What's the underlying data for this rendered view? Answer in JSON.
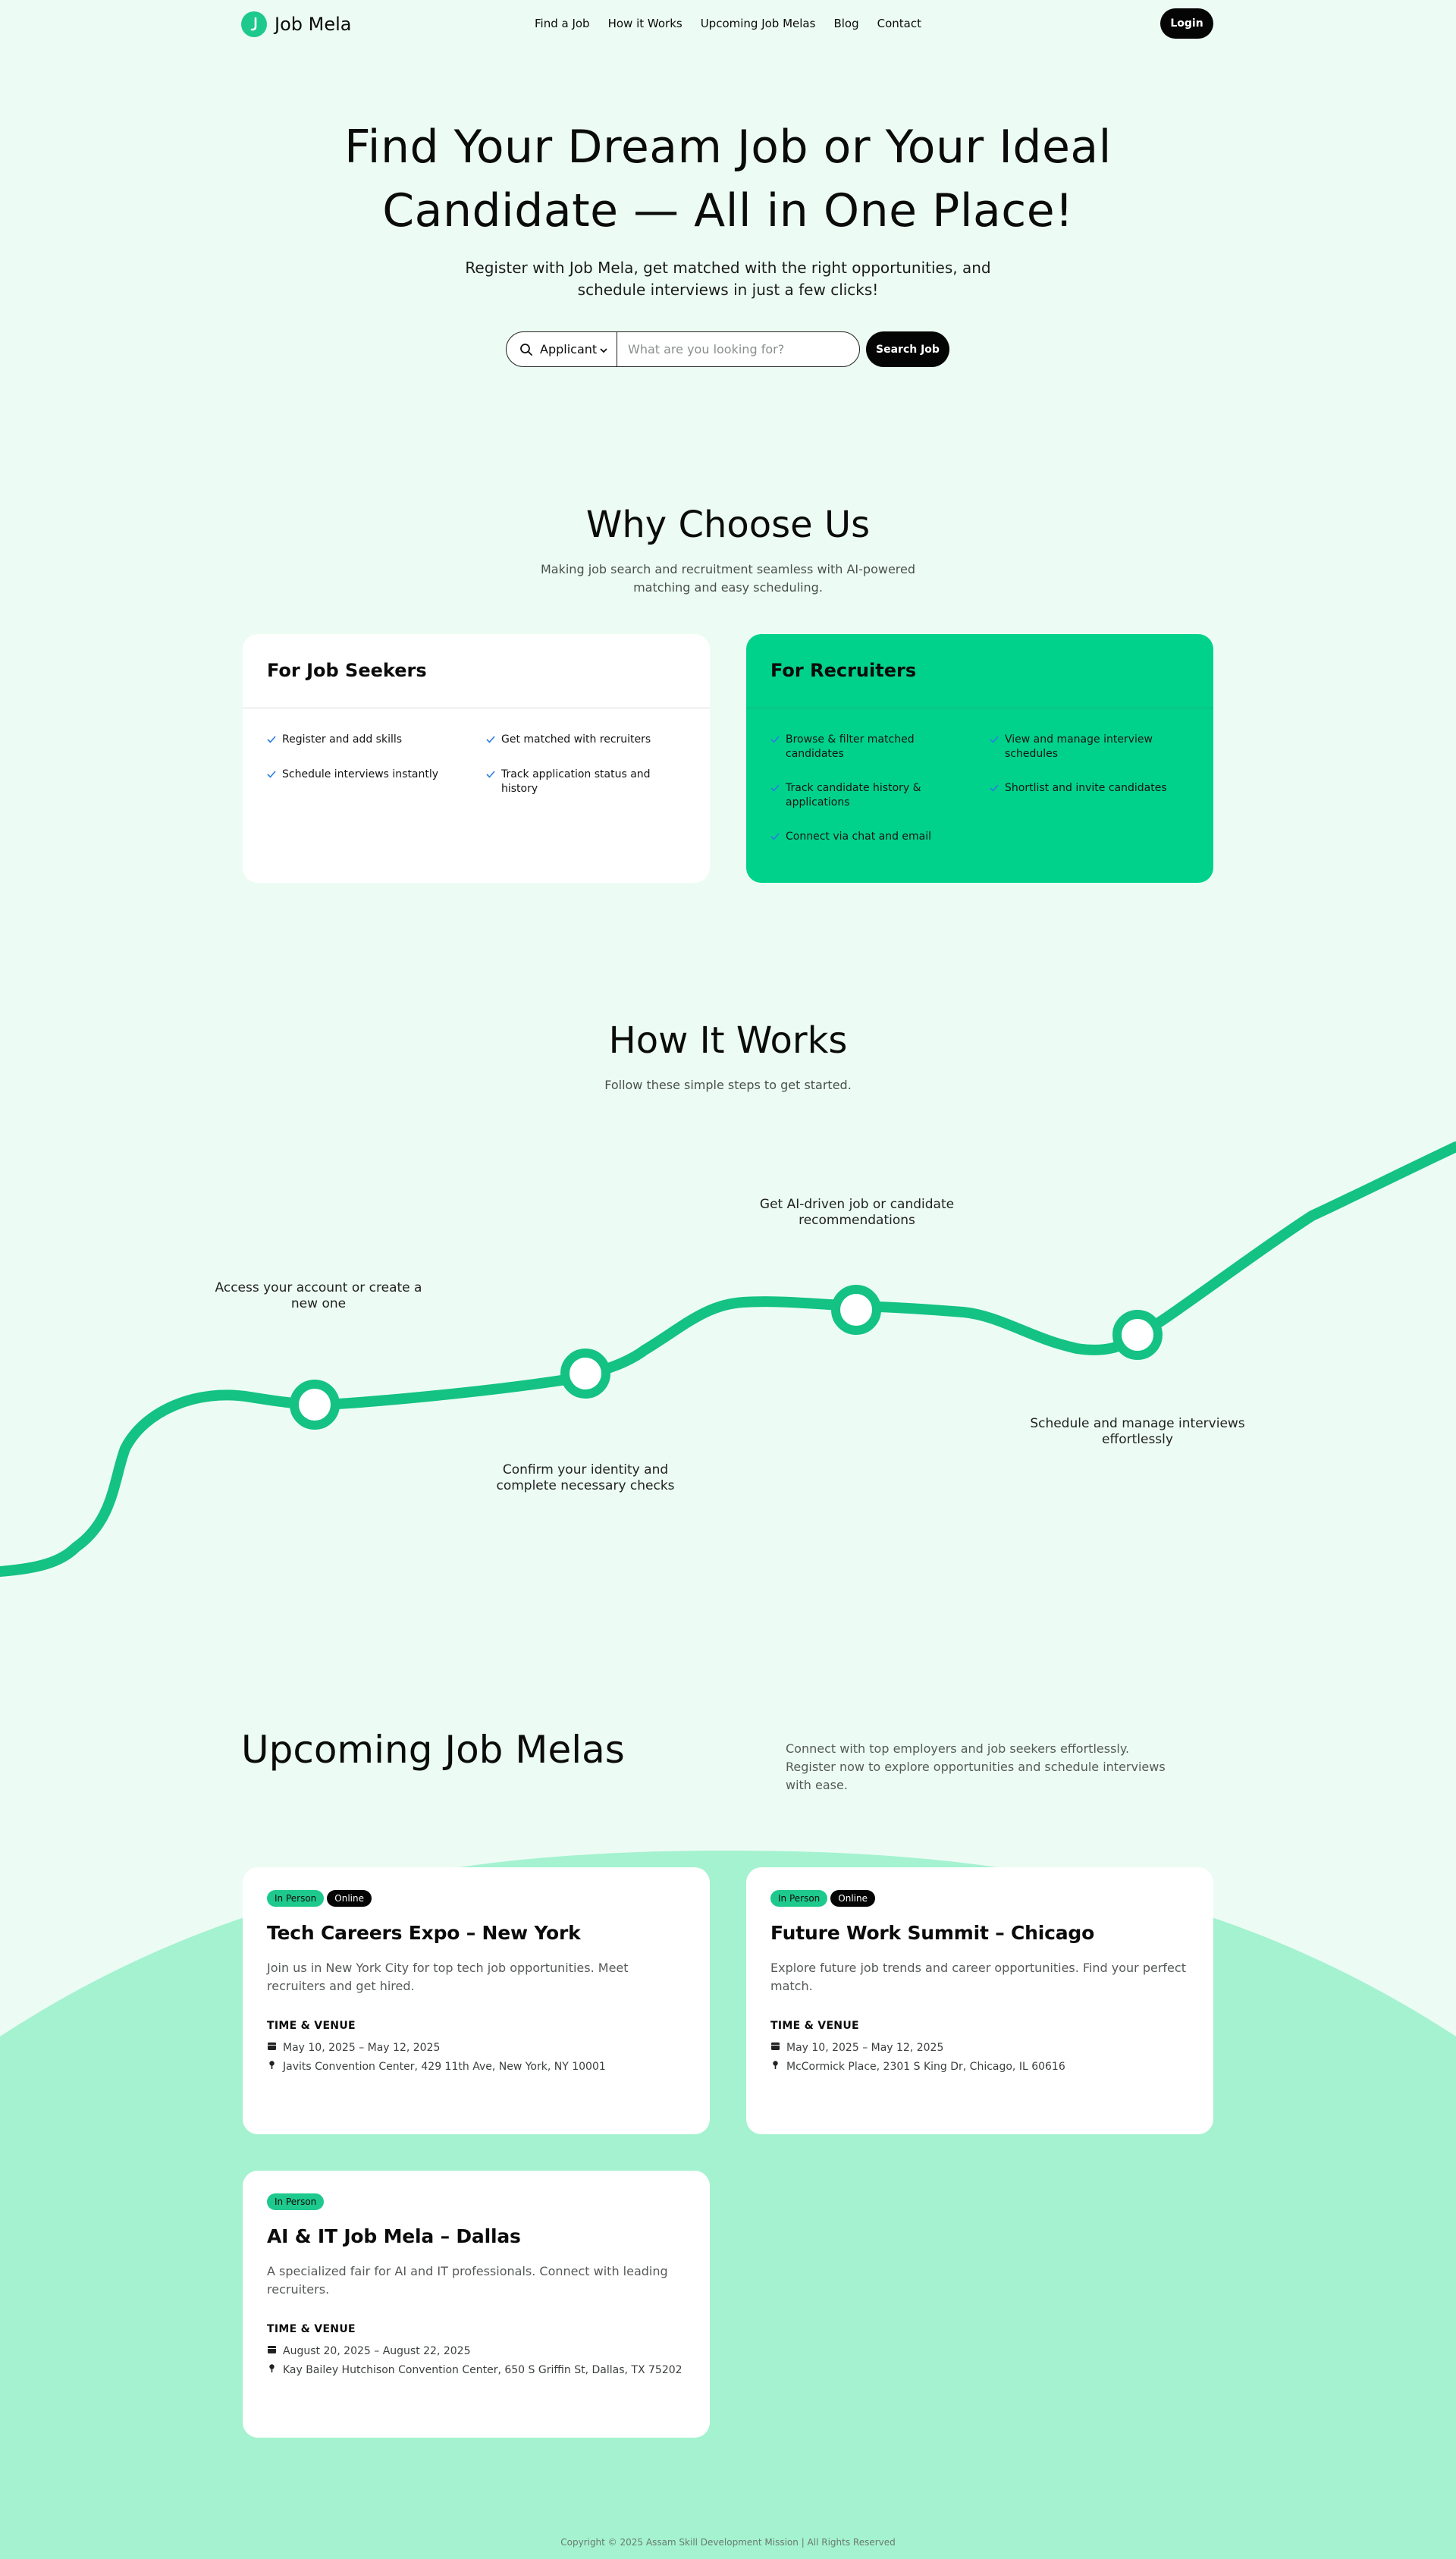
{
  "colors": {
    "accent": "#1ec98d",
    "recruiter_card": "#00d28c",
    "background": "#ecfcf4",
    "wave": "#a4f2d0",
    "dark": "#050505"
  },
  "nav": {
    "brand": "Job Mela",
    "links": [
      "Find a Job",
      "How it Works",
      "Upcoming Job Melas",
      "Blog",
      "Contact"
    ],
    "login": "Login"
  },
  "hero": {
    "title_line1": "Find Your Dream Job or Your Ideal",
    "title_line2": "Candidate — All in One Place!",
    "subtitle_line1": "Register with Job Mela, get matched with the right opportunities, and",
    "subtitle_line2": "schedule interviews in just a few clicks!",
    "search": {
      "role": "Applicant",
      "placeholder": "What are you looking for?",
      "button": "Search Job"
    }
  },
  "why": {
    "title": "Why Choose Us",
    "subtitle_line1": "Making job search and recruitment seamless with AI-powered",
    "subtitle_line2": "matching and easy scheduling.",
    "seekers": {
      "title": "For Job Seekers",
      "features": [
        "Register and add skills",
        "Get matched with recruiters",
        "Schedule interviews instantly",
        "Track application status and history"
      ]
    },
    "recruiters": {
      "title": "For Recruiters",
      "features": [
        "Browse & filter matched candidates",
        "View and manage interview schedules",
        "Track candidate history & applications",
        "Shortlist and invite candidates",
        "Connect via chat and email"
      ]
    }
  },
  "how": {
    "title": "How It Works",
    "subtitle": "Follow these simple steps to get started.",
    "steps": [
      "Access your account or create a new one",
      "Confirm your identity and complete necessary checks",
      "Get AI-driven job or candidate recommendations",
      "Schedule and manage interviews effortlessly"
    ]
  },
  "melas": {
    "title": "Upcoming Job Melas",
    "description": "Connect with top employers and job seekers effortlessly. Register now to explore opportunities and schedule interviews with ease.",
    "time_venue_label": "TIME & VENUE",
    "events": [
      {
        "tags": [
          "In Person",
          "Online"
        ],
        "title": "Tech Careers Expo – New York",
        "description": "Join us in New York City for top tech job opportunities. Meet recruiters and get hired.",
        "dates": "May 10, 2025 – May 12, 2025",
        "venue": "Javits Convention Center, 429 11th Ave, New York, NY 10001"
      },
      {
        "tags": [
          "In Person",
          "Online"
        ],
        "title": "Future Work Summit – Chicago",
        "description": "Explore future job trends and career opportunities. Find your perfect match.",
        "dates": "May 10, 2025 – May 12, 2025",
        "venue": "McCormick Place, 2301 S King Dr, Chicago, IL 60616"
      },
      {
        "tags": [
          "In Person"
        ],
        "title": "AI & IT Job Mela – Dallas",
        "description": "A specialized fair for AI and IT professionals. Connect with leading recruiters.",
        "dates": "August 20, 2025 – August 22, 2025",
        "venue": "Kay Bailey Hutchison Convention Center, 650 S Griffin St, Dallas, TX 75202"
      }
    ]
  },
  "footer": {
    "copyright": "Copyright © 2025 Assam Skill Development Mission | All Rights Reserved"
  }
}
